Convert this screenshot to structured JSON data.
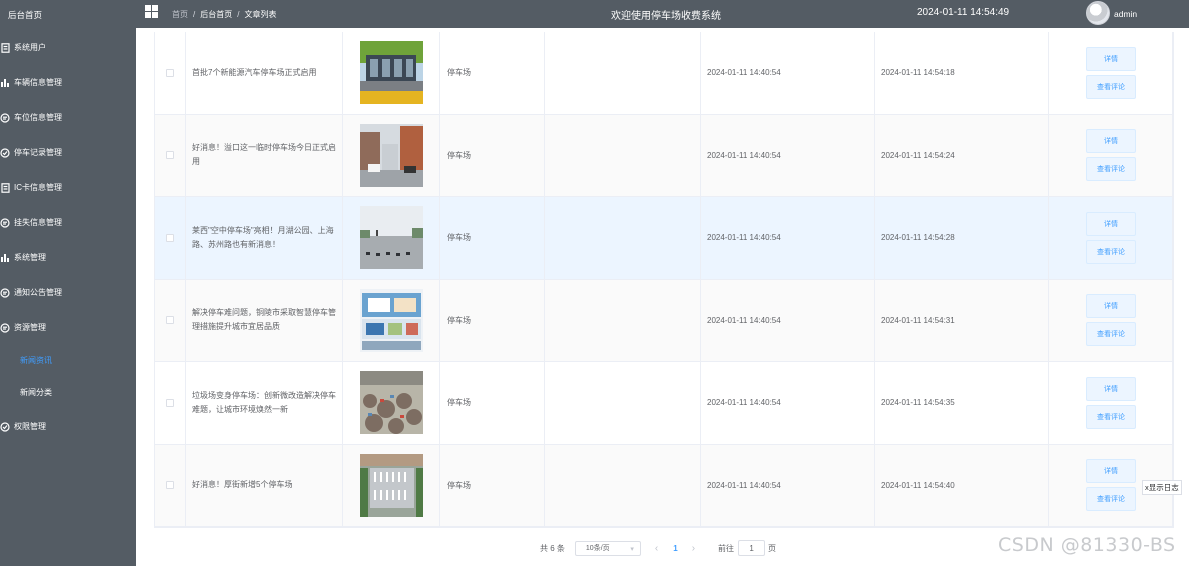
{
  "sidebar": {
    "home": "后台首页",
    "items": [
      {
        "label": "系统用户",
        "icon": "document-icon"
      },
      {
        "label": "车辆信息管理",
        "icon": "bar-chart-icon"
      },
      {
        "label": "车位信息管理",
        "icon": "chat-icon"
      },
      {
        "label": "停车记录管理",
        "icon": "check-circle-icon"
      },
      {
        "label": "IC卡信息管理",
        "icon": "document-icon"
      },
      {
        "label": "挂失信息管理",
        "icon": "chat-icon"
      },
      {
        "label": "系统管理",
        "icon": "bar-chart-icon"
      },
      {
        "label": "通知公告管理",
        "icon": "chat-icon"
      },
      {
        "label": "资源管理",
        "icon": "chat-icon"
      }
    ],
    "sub_items": [
      "新闻资讯",
      "新闻分类"
    ],
    "last_item": {
      "label": "权限管理",
      "icon": "check-circle-icon"
    }
  },
  "header": {
    "breadcrumbs": [
      "首页",
      "后台首页",
      "文章列表"
    ],
    "system_title": "欢迎使用停车场收费系统",
    "datetime": "2024-01-11 14:54:49",
    "username": "admin"
  },
  "rows": [
    {
      "title": "首批7个新能源汽车停车场正式启用",
      "type": "停车场",
      "created": "2024-01-11 14:40:54",
      "updated": "2024-01-11 14:54:18",
      "image": "parking-lot-photo"
    },
    {
      "title": "好消息！溢口这一临时停车场今日正式启用",
      "type": "停车场",
      "created": "2024-01-11 14:40:54",
      "updated": "2024-01-11 14:54:24",
      "image": "street-parking-photo"
    },
    {
      "title": "莱西\"空中停车场\"亮相！月湖公园、上海路、苏州路也有新消息！",
      "type": "停车场",
      "created": "2024-01-11 14:40:54",
      "updated": "2024-01-11 14:54:28",
      "image": "plaza-parking-photo"
    },
    {
      "title": "解决停车难问题，铜陵市采取智慧停车管理措施提升城市宜居品质",
      "type": "停车场",
      "created": "2024-01-11 14:40:54",
      "updated": "2024-01-11 14:54:31",
      "image": "exhibition-board-photo"
    },
    {
      "title": "垃圾场变身停车场：创新微改造解决停车难题，让城市环境焕然一新",
      "type": "停车场",
      "created": "2024-01-11 14:40:54",
      "updated": "2024-01-11 14:54:35",
      "image": "garbage-site-photo"
    },
    {
      "title": "好消息！厚街新增5个停车场",
      "type": "停车场",
      "created": "2024-01-11 14:40:54",
      "updated": "2024-01-11 14:54:40",
      "image": "aerial-parking-photo"
    }
  ],
  "actions": {
    "detail": "详情",
    "comments": "查看评论"
  },
  "pagination": {
    "total": "共 6 条",
    "page_size": "10条/页",
    "current_page": "1",
    "goto_label": "前往",
    "goto_value": "1",
    "page_unit": "页"
  },
  "log_toggle": "x显示日志",
  "watermark": "CSDN @81330-BS",
  "colors": {
    "sidebar_bg": "#545c64",
    "accent": "#409eff",
    "hover_row": "#ecf5ff"
  }
}
